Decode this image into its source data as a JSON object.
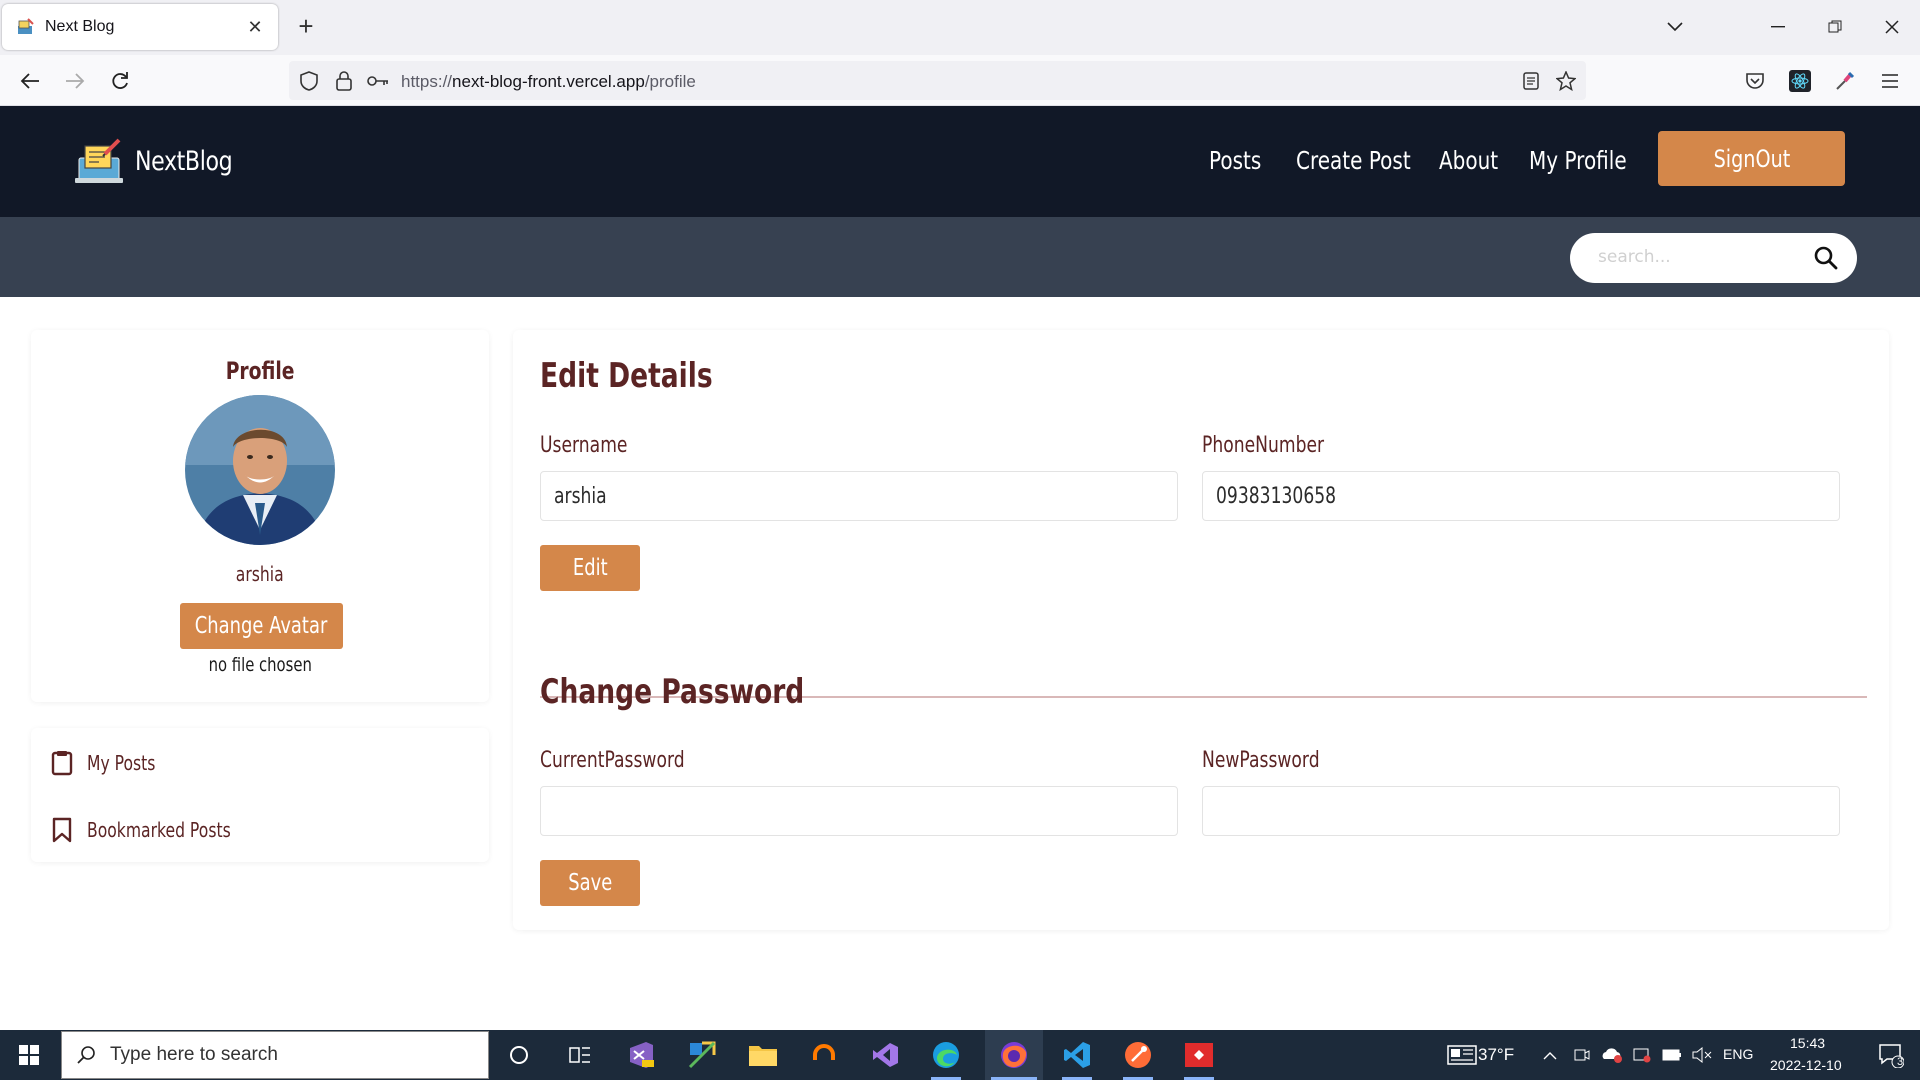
{
  "browser": {
    "tab_title": "Next Blog",
    "url_prefix": "https://",
    "url_host": "next-blog-front.vercel.app",
    "url_path": "/profile"
  },
  "site": {
    "brand": "NextBlog",
    "nav": [
      "Posts",
      "Create Post",
      "About",
      "My Profile"
    ],
    "signout": "SignOut",
    "search_placeholder": "search..."
  },
  "profile": {
    "title": "Profile",
    "username": "arshia",
    "change_avatar": "Change Avatar",
    "file_note": "no file chosen"
  },
  "sidebar": {
    "items": [
      {
        "label": "My Posts",
        "icon": "document-icon"
      },
      {
        "label": "Bookmarked Posts",
        "icon": "bookmark-icon"
      }
    ]
  },
  "edit_details": {
    "title": "Edit Details",
    "username_label": "Username",
    "username_value": "arshia",
    "phone_label": "PhoneNumber",
    "phone_value": "09383130658",
    "edit_button": "Edit"
  },
  "change_password": {
    "title": "Change Password",
    "current_label": "CurrentPassword",
    "current_value": "",
    "new_label": "NewPassword",
    "new_value": "",
    "save_button": "Save"
  },
  "taskbar": {
    "search_placeholder": "Type here to search",
    "temperature": "37°F",
    "language": "ENG",
    "time": "15:43",
    "date": "2022-12-10",
    "notification_count": "3"
  },
  "colors": {
    "header_bg": "#111827",
    "search_strip_bg": "#374151",
    "accent": "#d4874a",
    "text_brown": "#5b2424"
  }
}
